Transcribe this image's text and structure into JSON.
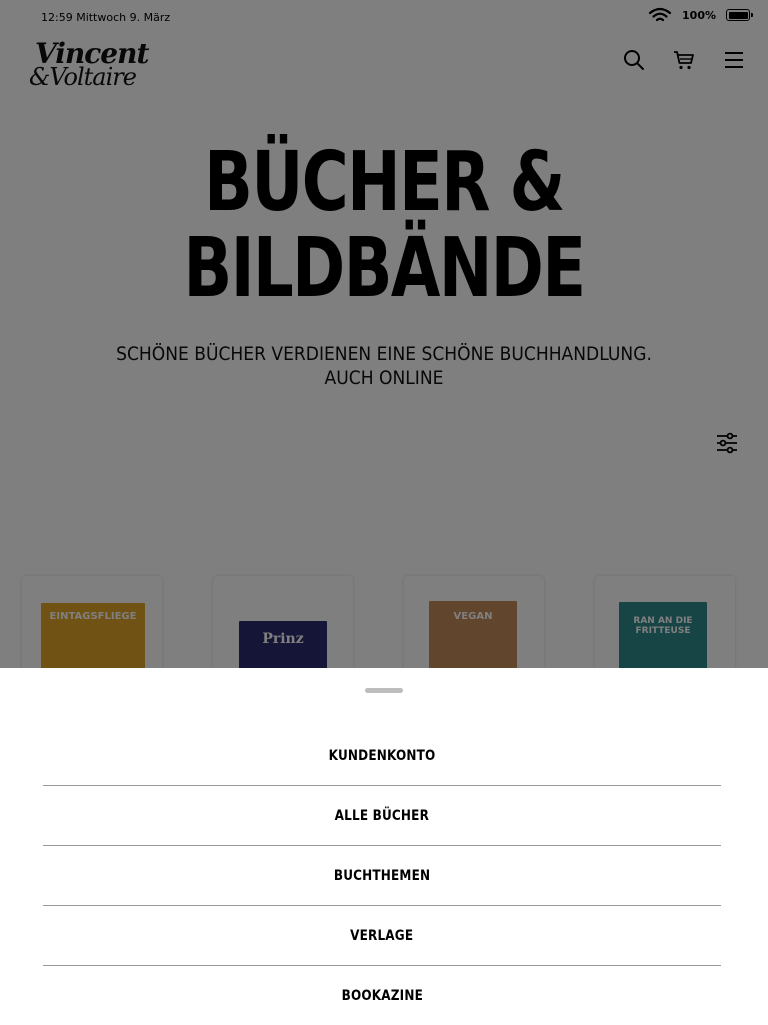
{
  "status_bar": {
    "time_date": "12:59 Mittwoch 9. März",
    "battery_percent": "100%"
  },
  "brand": {
    "logo_text": "Vincent & Voltaire"
  },
  "hero": {
    "title_line1": "BÜCHER &",
    "title_line2": "BILDBÄNDE",
    "subtitle_line1": "SCHÖNE BÜCHER VERDIENEN EINE SCHÖNE BUCHHANDLUNG.",
    "subtitle_line2": "AUCH ONLINE"
  },
  "books": [
    {
      "cover_text": "EINTAGSFLIEGE",
      "cover_color": "#e0a42a"
    },
    {
      "cover_text": "Prinz",
      "cover_color": "#2a2a6e"
    },
    {
      "cover_text": "VEGAN",
      "cover_color": "#c48a5a"
    },
    {
      "cover_text": "RAN AN DIE FRITTEUSE",
      "cover_color": "#2f8a8a"
    }
  ],
  "menu": {
    "items": [
      "KUNDENKONTO",
      "ALLE BÜCHER",
      "BUCHTHEMEN",
      "VERLAGE",
      "BOOKAZINE"
    ]
  },
  "colors": {
    "overlay": "rgba(0,0,0,0.5)",
    "sheet": "#ffffff",
    "divider": "#9a9a9a"
  },
  "icons": [
    "wifi-icon",
    "battery-icon",
    "search-icon",
    "cart-icon",
    "menu-icon",
    "filter-icon"
  ]
}
